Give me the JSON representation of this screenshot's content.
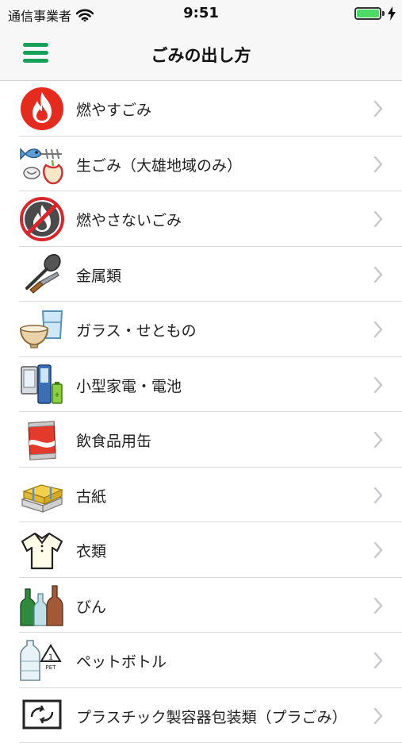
{
  "status": {
    "carrier": "通信事業者",
    "time": "9:51",
    "battery_level": 1.0
  },
  "nav": {
    "title": "ごみの出し方",
    "menu_icon": "hamburger-menu-icon"
  },
  "colors": {
    "accent": "#16a05a",
    "battery": "#4cd964"
  },
  "items": [
    {
      "label": "燃やすごみ",
      "icon": "flame-icon"
    },
    {
      "label": "生ごみ（大雄地域のみ）",
      "icon": "food-waste-icon"
    },
    {
      "label": "燃やさないごみ",
      "icon": "no-burn-icon"
    },
    {
      "label": "金属類",
      "icon": "metal-utensils-icon"
    },
    {
      "label": "ガラス・せともの",
      "icon": "glass-ceramics-icon"
    },
    {
      "label": "小型家電・電池",
      "icon": "small-appliance-battery-icon"
    },
    {
      "label": "飲食品用缶",
      "icon": "can-icon"
    },
    {
      "label": "古紙",
      "icon": "paper-bundle-icon"
    },
    {
      "label": "衣類",
      "icon": "shirt-icon"
    },
    {
      "label": "びん",
      "icon": "bottles-icon"
    },
    {
      "label": "ペットボトル",
      "icon": "pet-bottle-icon"
    },
    {
      "label": "プラスチック製容器包装類（プラごみ）",
      "icon": "plastic-container-icon"
    }
  ]
}
